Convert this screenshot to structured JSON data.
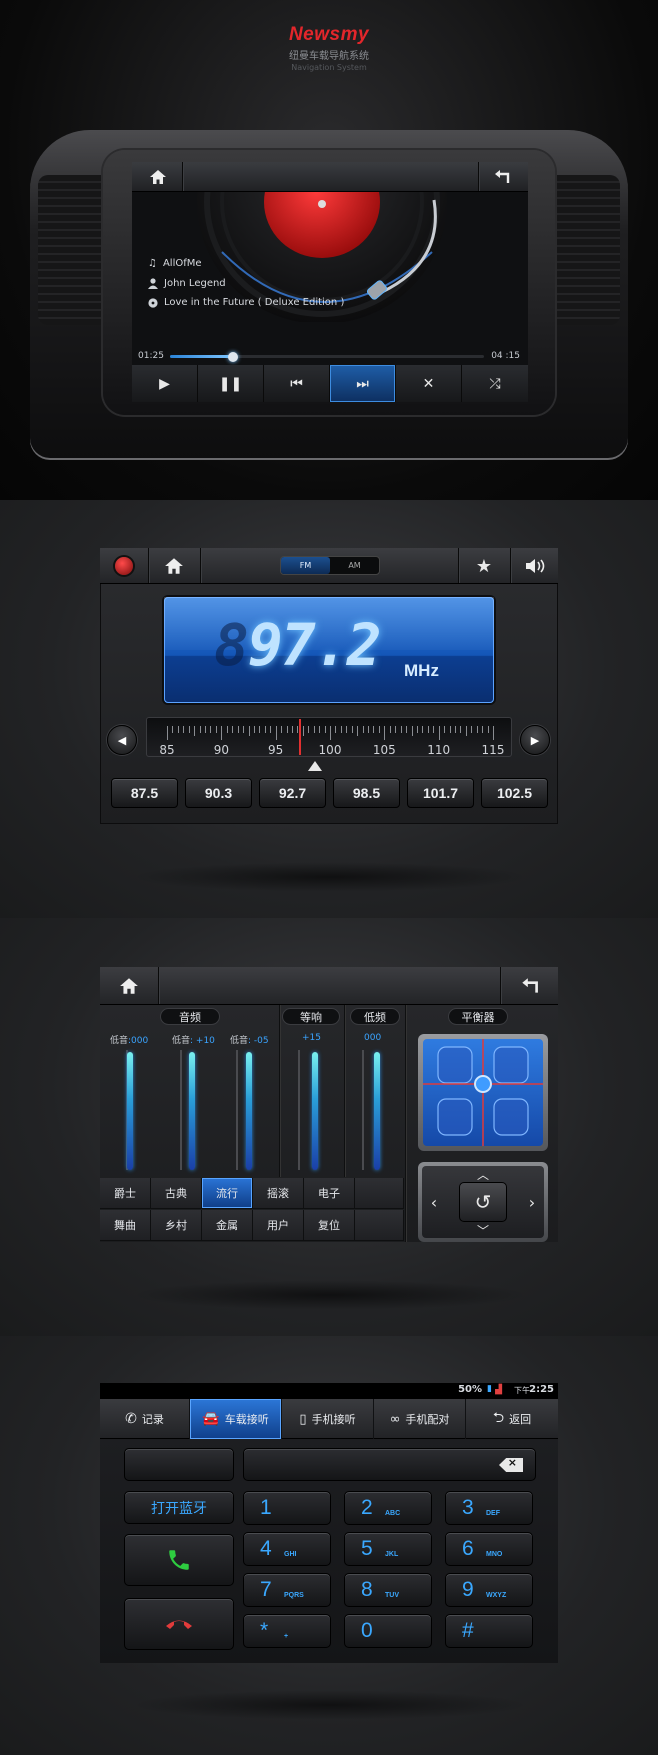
{
  "brand": {
    "logo": "Newsmy",
    "cn": "纽曼车载导航系统",
    "en": "Navigation System"
  },
  "player": {
    "track_title": "AllOfMe",
    "artist": "John Legend",
    "album": "Love in the Future ( Deluxe Edition )",
    "time_elapsed": "01:25",
    "time_total": "04 :15",
    "progress": 0.2,
    "icons": [
      "home-icon",
      "back-icon",
      "play-icon",
      "pause-icon",
      "prev-icon",
      "next-icon",
      "close-icon",
      "shuffle-icon"
    ]
  },
  "radio": {
    "band_fm": "FM",
    "band_am": "AM",
    "frequency": "97.2",
    "frequency_ghost": "8",
    "unit": "MHz",
    "scale_labels": [
      "85",
      "90",
      "95",
      "100",
      "105",
      "110",
      "115"
    ],
    "presets": [
      "87.5",
      "90.3",
      "92.7",
      "98.5",
      "101.7",
      "102.5"
    ],
    "colors": {
      "lcd": "#1456b7",
      "needle": "#e03030"
    }
  },
  "audio": {
    "tags": {
      "audio": "音频",
      "loudness": "等响",
      "bass": "低频",
      "balance": "平衡器"
    },
    "sliders": [
      {
        "label": "低音",
        "value": ":000"
      },
      {
        "label": "低音",
        "value": ": +10"
      },
      {
        "label": "低音",
        "value": ": -05"
      },
      {
        "label": "",
        "value": "+15"
      },
      {
        "label": "",
        "value": "000"
      }
    ],
    "presets": [
      "爵士",
      "古典",
      "流行",
      "摇滚",
      "电子",
      "",
      "舞曲",
      "乡村",
      "金属",
      "用户",
      "复位",
      ""
    ],
    "active_preset": "流行"
  },
  "phone": {
    "status": {
      "battery": "50%",
      "ampm": "下午",
      "clock": "2:25"
    },
    "tabs": [
      "记录",
      "车载接听",
      "手机接听",
      "手机配对",
      "返回"
    ],
    "active_tab": "车载接听",
    "bluetooth_button": "打开蓝牙",
    "keys": [
      {
        "d": "1",
        "s": ""
      },
      {
        "d": "2",
        "s": "ABC"
      },
      {
        "d": "3",
        "s": "DEF"
      },
      {
        "d": "4",
        "s": "GHI"
      },
      {
        "d": "5",
        "s": "JKL"
      },
      {
        "d": "6",
        "s": "MNO"
      },
      {
        "d": "7",
        "s": "PQRS"
      },
      {
        "d": "8",
        "s": "TUV"
      },
      {
        "d": "9",
        "s": "WXYZ"
      },
      {
        "d": "*",
        "s": "+"
      },
      {
        "d": "0",
        "s": ""
      },
      {
        "d": "#",
        "s": ""
      }
    ]
  }
}
